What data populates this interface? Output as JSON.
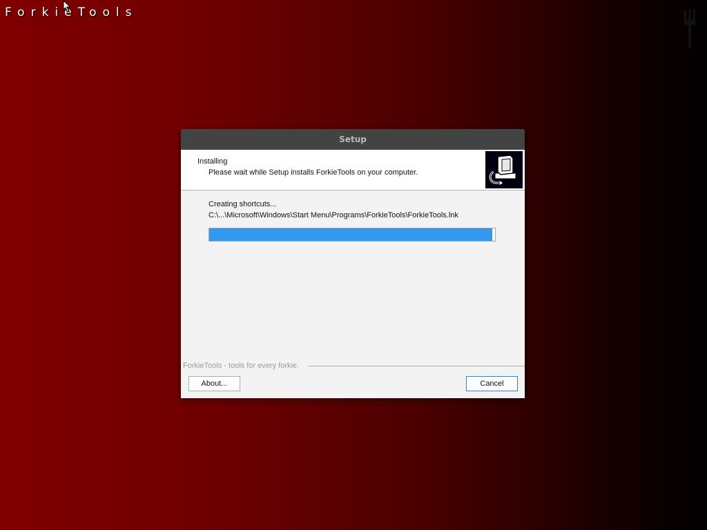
{
  "desktop": {
    "title": "ForkieTools"
  },
  "window": {
    "title": "Setup"
  },
  "header": {
    "title": "Installing",
    "subtitle": "Please wait while Setup installs ForkieTools on your computer.",
    "icon": "installer-computer-icon"
  },
  "progress": {
    "status": "Creating shortcuts...",
    "detail": "C:\\...\\Microsoft\\Windows\\Start Menu\\Programs\\ForkieTools\\ForkieTools.lnk",
    "percent": 99
  },
  "branding": {
    "text": "ForkieTools - tools for every forkie."
  },
  "buttons": {
    "about": "About...",
    "cancel": "Cancel"
  },
  "colors": {
    "progress_fill": "#3399ee",
    "titlebar": "#434343"
  }
}
